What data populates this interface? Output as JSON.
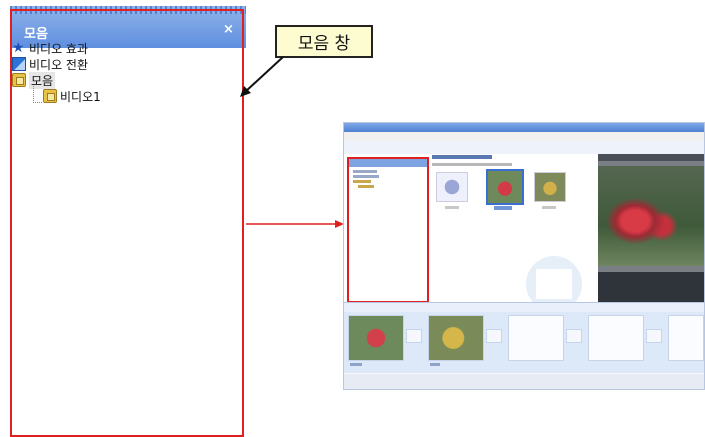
{
  "pane": {
    "title": "모음",
    "close": "×",
    "items": [
      {
        "label": "비디오 효과",
        "icon": "star-icon"
      },
      {
        "label": "비디오 전환",
        "icon": "transition-icon"
      },
      {
        "label": "모음",
        "icon": "collection-icon"
      },
      {
        "label": "비디오1",
        "icon": "collection-icon"
      }
    ]
  },
  "callout": {
    "text": "모음 창"
  },
  "colors": {
    "highlight": "#e02020",
    "pane_header": "#6f9be4",
    "callout_bg": "#fdfbd0"
  }
}
